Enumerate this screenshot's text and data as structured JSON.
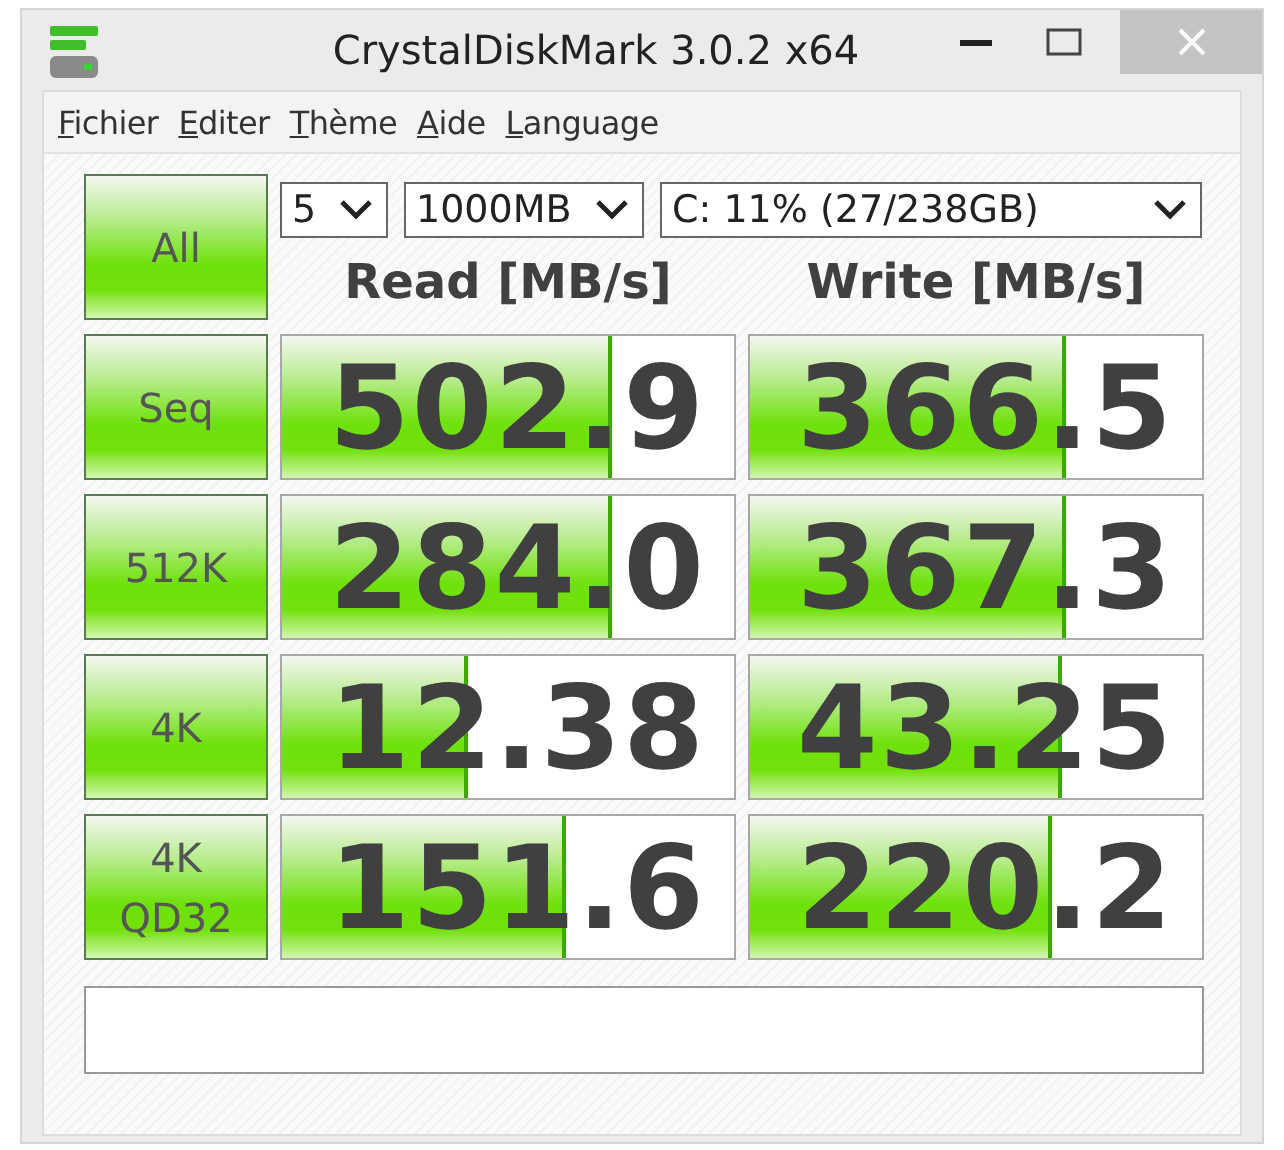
{
  "window": {
    "title": "CrystalDiskMark 3.0.2 x64"
  },
  "menu": [
    {
      "label": "Fichier"
    },
    {
      "label": "Editer"
    },
    {
      "label": "Thème"
    },
    {
      "label": "Aide"
    },
    {
      "label": "Language"
    }
  ],
  "all_button": "All",
  "settings": {
    "runs": "5",
    "size": "1000MB",
    "drive": "C: 11% (27/238GB)"
  },
  "columns": [
    "Read [MB/s]",
    "Write [MB/s]"
  ],
  "rows": [
    {
      "test": "Seq",
      "read": {
        "value": "502.9",
        "level": 0.73
      },
      "write": {
        "value": "366.5",
        "level": 0.7
      }
    },
    {
      "test": "512K",
      "read": {
        "value": "284.0",
        "level": 0.73
      },
      "write": {
        "value": "367.3",
        "level": 0.7
      }
    },
    {
      "test": "4K",
      "read": {
        "value": "12.38",
        "level": 0.41
      },
      "write": {
        "value": "43.25",
        "level": 0.69
      }
    },
    {
      "test": "4K QD32",
      "read": {
        "value": "151.6",
        "level": 0.63
      },
      "write": {
        "value": "220.2",
        "level": 0.67
      }
    }
  ]
}
